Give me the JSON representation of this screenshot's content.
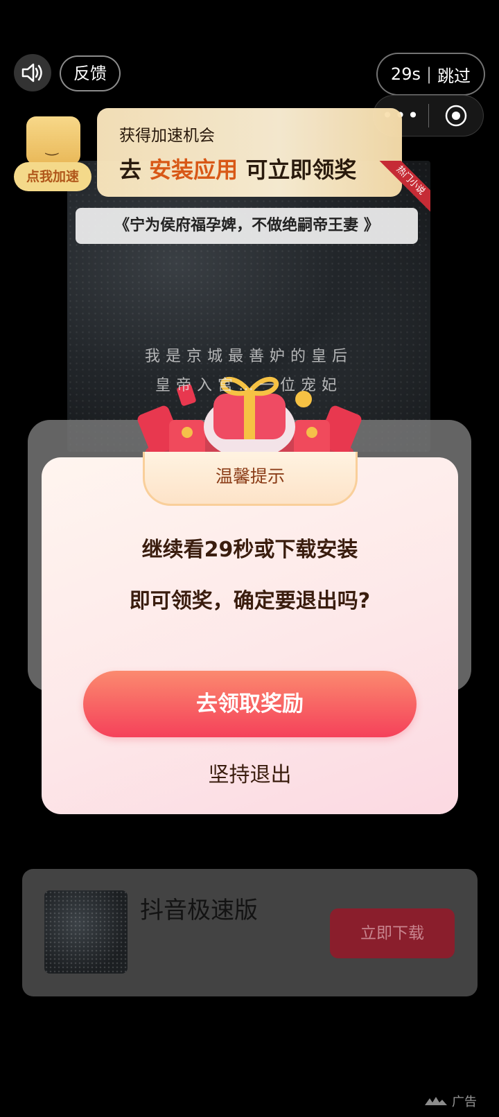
{
  "top_controls": {
    "feedback_label": "反馈",
    "skip_countdown": "29s",
    "skip_label": "跳过",
    "capsule_more": "•••"
  },
  "speed_banner": {
    "gift_tag": "点我加速",
    "line1": "获得加速机会",
    "line2_prefix": "去",
    "line2_highlight": "安装应用",
    "line2_suffix": "可立即领奖"
  },
  "video": {
    "ribbon": "热门小说",
    "title": "《宁为侯府福孕婢，不做绝嗣帝王妻 》",
    "subtitle_lines": [
      "我是京城最善妒的皇后",
      "皇帝入宫…一位宠妃"
    ]
  },
  "dialog": {
    "header": "温馨提示",
    "message_line1": "继续看29秒或下载安装",
    "message_line2": "即可领奖，确定要退出吗?",
    "primary_button": "去领取奖励",
    "quit_button": "坚持退出"
  },
  "app_card": {
    "app_name": "抖音极速版",
    "download_button": "立即下载"
  },
  "ad_label": "广告",
  "colors": {
    "primary_gradient_top": "#fb8a6f",
    "primary_gradient_bottom": "#f5415a",
    "highlight": "#e05a16",
    "download_button": "#8a1e2c"
  }
}
